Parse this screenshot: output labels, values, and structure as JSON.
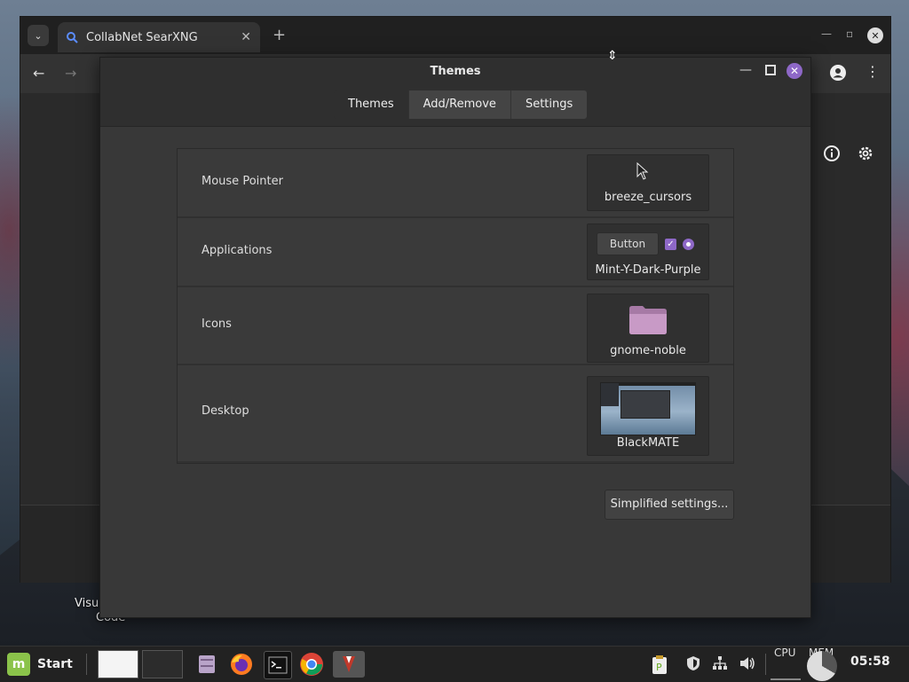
{
  "desktop": {
    "label_line1": "Visu",
    "label_line2": "Code"
  },
  "browser": {
    "tab_title": "CollabNet SearXNG",
    "tab_close": "✕",
    "new_tab": "+",
    "back": "←",
    "forward": "→"
  },
  "themes": {
    "title": "Themes",
    "tabs": [
      {
        "label": "Themes",
        "active": true
      },
      {
        "label": "Add/Remove",
        "active": false
      },
      {
        "label": "Settings",
        "active": false
      }
    ],
    "rows": [
      {
        "label": "Mouse Pointer",
        "value": "breeze_cursors"
      },
      {
        "label": "Applications",
        "value": "Mint-Y-Dark-Purple",
        "demo_button": "Button"
      },
      {
        "label": "Icons",
        "value": "gnome-noble"
      },
      {
        "label": "Desktop",
        "value": "BlackMATE"
      }
    ],
    "simplified_button": "Simplified settings...",
    "accent_color": "#8e68c7"
  },
  "taskbar": {
    "start_label": "Start",
    "cpu_label": "CPU",
    "mem_label": "MEM",
    "clock": "05:58"
  }
}
